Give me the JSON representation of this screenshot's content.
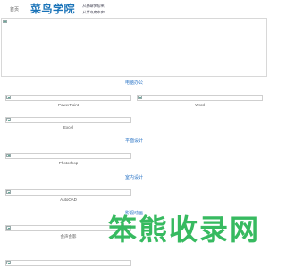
{
  "header": {
    "nav_home": "首页",
    "logo_text": "菜鸟学院",
    "slogan_line1": "从基础学起来,",
    "slogan_line2": "从菜鸟变专家!"
  },
  "sections": [
    {
      "title": "电脑办公",
      "items": [
        "PowerPoint",
        "Word",
        "Excel"
      ]
    },
    {
      "title": "平面设计",
      "items": [
        "Photoshop"
      ]
    },
    {
      "title": "室内设计",
      "items": [
        "AutoCAD"
      ]
    },
    {
      "title": "影视动画",
      "items": [
        "会声会影"
      ]
    }
  ],
  "watermark": "笨熊收录网",
  "colors": {
    "accent": "#2a74c6",
    "logo": "#1a73b8",
    "watermark": "#22b34f"
  }
}
